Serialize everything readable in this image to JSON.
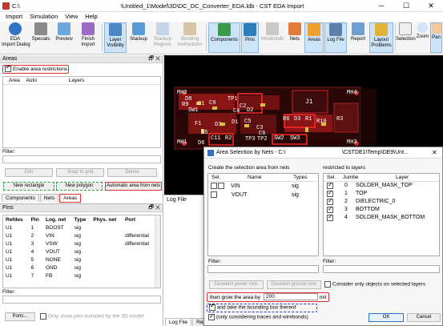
{
  "titlebar": {
    "left_path": "C:\\",
    "title": "\\Untitled_1\\Model\\3D\\DC_DC_Converter_EDA.ldb - CST EDA Import",
    "min": "─",
    "max": "☐",
    "close": "✕"
  },
  "menu": [
    "Import",
    "Simulation",
    "View",
    "Help"
  ],
  "ribbon": {
    "eda_import": "EDA\nImport Dialog",
    "specials": "Specials",
    "preview": "Preview",
    "finish_import": "Finish\nImport",
    "layer_visibility": "Layer\nVisibility",
    "stackup": "Stackup",
    "stackup_regions": "Stackup\nRegions",
    "bending": "Bending\nInstructions",
    "components": "Components",
    "pins": "Pins",
    "wirebonds": "Wirebonds",
    "nets": "Nets",
    "areas": "Areas",
    "log_file": "Log File",
    "report": "Report",
    "layout_problems": "Layout\nProblems",
    "selection": "Selection",
    "zoom": "Zoom",
    "pan": "Pan"
  },
  "areas_panel": {
    "title": "Areas",
    "pin_icons": "🗗 ✕",
    "enable_label": "Enable area restrictions",
    "col_area": "Area",
    "col_auto": "Auto",
    "col_layers": "Layers",
    "filter_label": "Filter:",
    "edit": "Edit",
    "snap": "Snap to grid",
    "delete": "Delete",
    "new_rect": "New rectangle",
    "new_poly": "New polygon",
    "auto_nets": "Automatic area from nets",
    "tabs": [
      "Components",
      "Nets",
      "Areas"
    ]
  },
  "pins_panel": {
    "title": "Pins",
    "pin_icons": "🗗 ✕",
    "headers": [
      "Refdes",
      "Pin",
      "Log. net",
      "Type",
      "Phys. net",
      "Port"
    ],
    "rows": [
      [
        "U1",
        "1",
        "BOOST",
        "sig",
        "",
        ""
      ],
      [
        "U1",
        "2",
        "VIN",
        "sig",
        "",
        "differential"
      ],
      [
        "U1",
        "3",
        "VSW",
        "sig",
        "",
        "differential"
      ],
      [
        "U1",
        "4",
        "VOUT",
        "sig",
        "",
        ""
      ],
      [
        "U1",
        "5",
        "NONE",
        "sig",
        "",
        ""
      ],
      [
        "U1",
        "6",
        "GND",
        "sig",
        "",
        ""
      ],
      [
        "U1",
        "7",
        "FB",
        "sig",
        "",
        ""
      ]
    ],
    "filter_label": "Filter:",
    "ports_btn": "Ports...",
    "only_show": "Only show pins included by the 3D model"
  },
  "pcb": {
    "labels": [
      "MH2",
      "MH4",
      "MH1",
      "MH3",
      "D8",
      "R9",
      "C1",
      "C9",
      "SW1",
      "TP1",
      "C2",
      "D2",
      "C4",
      "J1",
      "R6",
      "D3",
      "R1",
      "R10",
      "R3",
      "F1",
      "D3",
      "D1",
      "C5",
      "C3",
      "D5",
      "C6",
      "C11",
      "R2",
      "TP3",
      "TP2",
      "SW2",
      "SW3",
      "D6"
    ]
  },
  "logfile": {
    "title": "Log File",
    "tab1": "Log File",
    "tab2": "Repo"
  },
  "dialog": {
    "title": "Area Selection by Nets - C:\\",
    "title_right": "\\CSTDE1\\Temp\\DE9\\Unt...",
    "close": "✕",
    "left_label": "Create the selection area from nets",
    "right_label": "restricted to layers",
    "nets_headers": [
      "Sel.",
      "Name",
      "Types"
    ],
    "nets": [
      {
        "name": "VIN",
        "type": "sig"
      },
      {
        "name": "VOUT",
        "type": "sig"
      }
    ],
    "layers_headers": [
      "Sel.",
      "Jumbe",
      "Layer"
    ],
    "layers": [
      {
        "num": "0",
        "name": "SOLDER_MASK_TOP"
      },
      {
        "num": "1",
        "name": "TOP"
      },
      {
        "num": "2",
        "name": "DIELECTRIC_0"
      },
      {
        "num": "3",
        "name": "BOTTOM"
      },
      {
        "num": "4",
        "name": "SOLDER_MASK_BOTTOM"
      }
    ],
    "filter_label": "Filter:",
    "deselect_power": "Deselect power nets",
    "deselect_ground": "Deselect ground nets",
    "consider_only": "Consider only objects on selected layers",
    "grow_label": "then grow the area by",
    "grow_value": "200",
    "grow_unit": "mil",
    "bbox_label": "and take the bounding box thereof",
    "traces_label": "(only considering traces and wirebonds).",
    "ok": "OK",
    "cancel": "Cancel"
  }
}
